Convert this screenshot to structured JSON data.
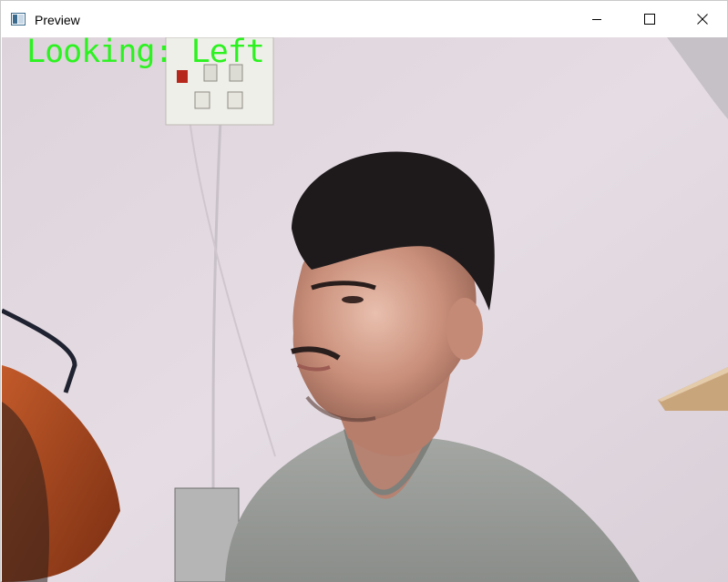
{
  "window": {
    "title": "Preview",
    "icon": "app-window-icon",
    "controls": {
      "minimize_icon": "minimize-icon",
      "maximize_icon": "maximize-icon",
      "close_icon": "close-icon"
    }
  },
  "video": {
    "overlay_text": "Looking: Left",
    "overlay_color": "#2cf220",
    "scene_description": "webcam-frame"
  }
}
